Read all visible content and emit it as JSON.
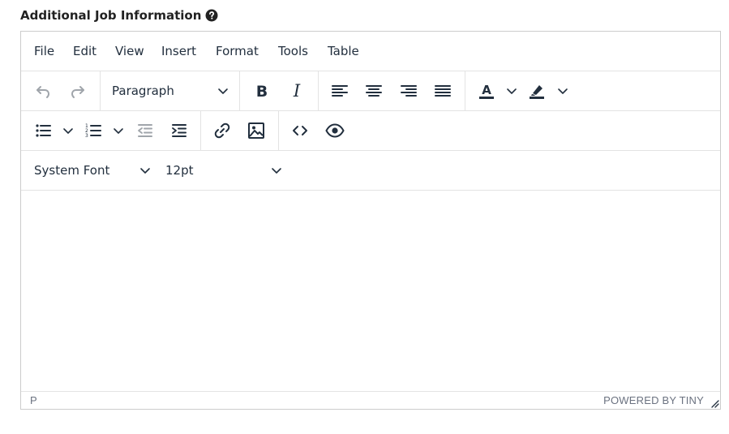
{
  "field": {
    "label": "Additional Job Information",
    "help_icon": "question-circle-icon"
  },
  "menubar": {
    "items": [
      {
        "label": "File"
      },
      {
        "label": "Edit"
      },
      {
        "label": "View"
      },
      {
        "label": "Insert"
      },
      {
        "label": "Format"
      },
      {
        "label": "Tools"
      },
      {
        "label": "Table"
      }
    ]
  },
  "toolbar": {
    "block_format": "Paragraph",
    "font_family": "System Font",
    "font_size": "12pt",
    "icons": [
      "undo-icon",
      "redo-icon",
      "bold-icon",
      "italic-icon",
      "align-left-icon",
      "align-center-icon",
      "align-right-icon",
      "align-justify-icon",
      "text-color-icon",
      "highlight-icon",
      "bullet-list-icon",
      "numbered-list-icon",
      "outdent-icon",
      "indent-icon",
      "link-icon",
      "image-icon",
      "code-icon",
      "preview-icon"
    ]
  },
  "statusbar": {
    "path": "P",
    "brand": "POWERED BY TINY"
  },
  "colors": {
    "text": "#222f3e",
    "border": "#cccccc",
    "disabled": "#a0a5ab",
    "separator": "#e3e3e3"
  }
}
